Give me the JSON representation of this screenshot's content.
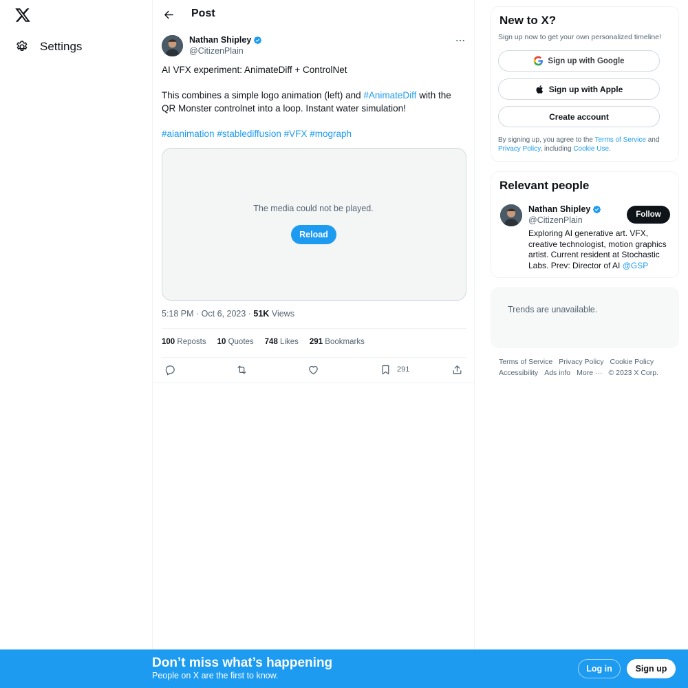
{
  "nav": {
    "settings_label": "Settings"
  },
  "post": {
    "header_title": "Post",
    "author_name": "Nathan Shipley",
    "author_handle": "@CitizenPlain",
    "text_line1": "AI VFX experiment: AnimateDiff + ControlNet",
    "text_para2_before": "This combines a simple logo animation (left) and ",
    "text_para2_tag": "#AnimateDiff",
    "text_para2_after": " with the QR Monster controlnet into a loop. Instant water simulation!",
    "hashtags": [
      "#aianimation",
      "#stablediffusion",
      "#VFX",
      "#mograph"
    ],
    "media_message": "The media could not be played.",
    "reload_label": "Reload",
    "time": "5:18 PM",
    "date": "Oct 6, 2023",
    "views_count": "51K",
    "views_label": "Views",
    "stats": {
      "reposts_count": "100",
      "reposts_label": "Reposts",
      "quotes_count": "10",
      "quotes_label": "Quotes",
      "likes_count": "748",
      "likes_label": "Likes",
      "bookmarks_count": "291",
      "bookmarks_label": "Bookmarks"
    },
    "bookmark_action_count": "291"
  },
  "signup_card": {
    "title": "New to X?",
    "subtitle": "Sign up now to get your own personalized timeline!",
    "google_label": "Sign up with Google",
    "apple_label": "Sign up with Apple",
    "create_label": "Create account",
    "legal_before": "By signing up, you agree to the ",
    "legal_terms": "Terms of Service",
    "legal_and": " and ",
    "legal_privacy": "Privacy Policy",
    "legal_including": ", including ",
    "legal_cookie": "Cookie Use",
    "legal_end": "."
  },
  "relevant_people": {
    "title": "Relevant people",
    "name": "Nathan Shipley",
    "handle": "@CitizenPlain",
    "follow_label": "Follow",
    "bio_text": "Exploring AI generative art. VFX, creative technologist, motion graphics artist. Current resident at Stochastic Labs. Prev: Director of AI ",
    "bio_link": "@GSP"
  },
  "trends": {
    "message": "Trends are unavailable."
  },
  "footer": {
    "terms": "Terms of Service",
    "privacy": "Privacy Policy",
    "cookie": "Cookie Policy",
    "accessibility": "Accessibility",
    "ads": "Ads info",
    "more": "More ···",
    "copyright": "© 2023 X Corp."
  },
  "banner": {
    "title": "Don’t miss what’s happening",
    "subtitle": "People on X are the first to know.",
    "login_label": "Log in",
    "signup_label": "Sign up"
  },
  "colors": {
    "accent": "#1d9bf0",
    "text": "#0f1419",
    "muted": "#536471"
  }
}
